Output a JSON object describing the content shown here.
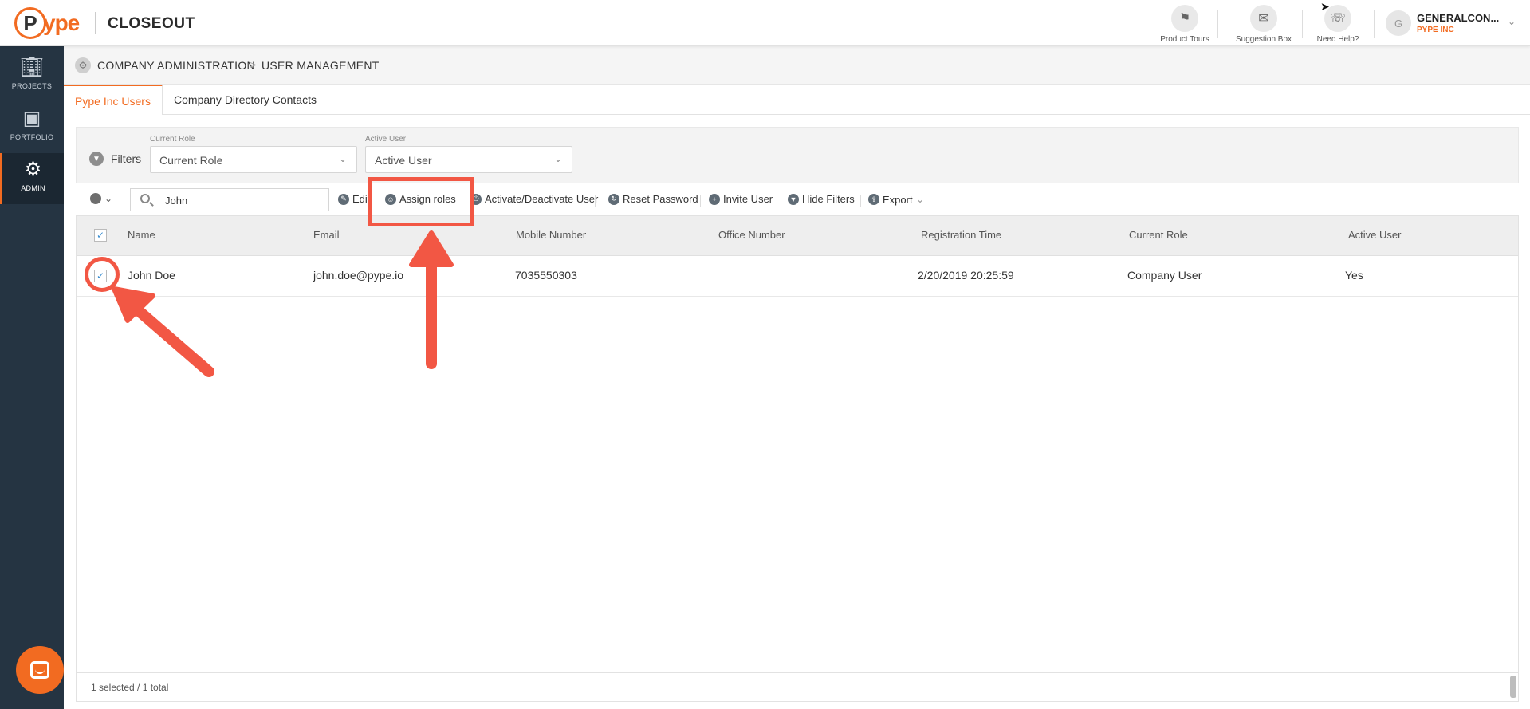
{
  "header": {
    "logo_letter": "P",
    "logo_rest": "ype",
    "app_title": "CLOSEOUT",
    "tools": [
      {
        "label": "Product Tours",
        "icon": "signpost-icon"
      },
      {
        "label": "Suggestion Box",
        "icon": "suggestion-box-icon"
      },
      {
        "label": "Need Help?",
        "icon": "phone-help-icon"
      }
    ],
    "user": {
      "initial": "G",
      "name": "GENERALCON...",
      "company": "PYPE INC"
    }
  },
  "sidebar": {
    "items": [
      {
        "label": "PROJECTS",
        "icon": "building-icon",
        "active": false
      },
      {
        "label": "PORTFOLIO",
        "icon": "briefcase-icon",
        "active": false
      },
      {
        "label": "ADMIN",
        "icon": "gear-icon",
        "active": true
      }
    ]
  },
  "breadcrumb": {
    "first": "COMPANY ADMINISTRATION",
    "separator": ">",
    "second": "USER MANAGEMENT"
  },
  "tabs": [
    {
      "label": "Pype Inc Users",
      "active": true
    },
    {
      "label": "Company Directory Contacts",
      "active": false
    }
  ],
  "filters": {
    "label": "Filters",
    "current_role": {
      "label": "Current Role",
      "value": "Current Role"
    },
    "active_user": {
      "label": "Active User",
      "value": "Active User"
    }
  },
  "toolbar": {
    "search_value": "John",
    "edit": "Edit",
    "assign_roles": "Assign roles",
    "activate": "Activate/Deactivate User",
    "reset_password": "Reset Password",
    "invite_user": "Invite User",
    "hide_filters": "Hide Filters",
    "export": "Export"
  },
  "table": {
    "columns": [
      "Name",
      "Email",
      "Mobile Number",
      "Office Number",
      "Registration Time",
      "Current Role",
      "Active User"
    ],
    "rows": [
      {
        "name": "John Doe",
        "email": "john.doe@pype.io",
        "mobile": "7035550303",
        "office": "",
        "registration": "2/20/2019 20:25:59",
        "role": "Company User",
        "active": "Yes",
        "selected": true
      }
    ],
    "footer": "1 selected / 1 total"
  },
  "colors": {
    "accent": "#f26b21",
    "annotation": "#f25744",
    "sidebar": "#253442"
  }
}
